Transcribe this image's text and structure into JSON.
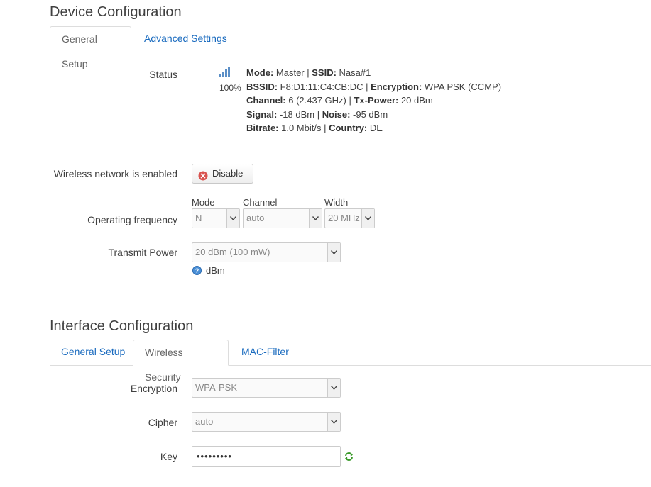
{
  "device": {
    "title": "Device Configuration",
    "tabs": [
      {
        "label": "General Setup",
        "active": true
      },
      {
        "label": "Advanced Settings",
        "active": false
      }
    ],
    "status": {
      "label": "Status",
      "signal_percent": "100%",
      "lines": [
        {
          "k1": "Mode:",
          "v1": " Master | ",
          "k2": "SSID:",
          "v2": " Nasa#1",
          "k3": "",
          "v3": ""
        },
        {
          "k1": "BSSID:",
          "v1": " F8:D1:11:C4:CB:DC | ",
          "k2": "Encryption:",
          "v2": " WPA PSK (CCMP)",
          "k3": "",
          "v3": ""
        },
        {
          "k1": "Channel:",
          "v1": " 6 (2.437 GHz) | ",
          "k2": "Tx-Power:",
          "v2": " 20 dBm",
          "k3": "",
          "v3": ""
        },
        {
          "k1": "Signal:",
          "v1": " -18 dBm | ",
          "k2": "Noise:",
          "v2": " -95 dBm",
          "k3": "",
          "v3": ""
        },
        {
          "k1": "Bitrate:",
          "v1": " 1.0 Mbit/s | ",
          "k2": "Country:",
          "v2": " DE",
          "k3": "",
          "v3": ""
        }
      ]
    },
    "wireless_enabled": {
      "label": "Wireless network is enabled",
      "button": "Disable"
    },
    "operating_frequency": {
      "label": "Operating frequency",
      "mode": {
        "label": "Mode",
        "value": "N"
      },
      "channel": {
        "label": "Channel",
        "value": "auto"
      },
      "width": {
        "label": "Width",
        "value": "20 MHz"
      }
    },
    "transmit_power": {
      "label": "Transmit Power",
      "value": "20 dBm (100 mW)",
      "hint": "dBm"
    }
  },
  "interface": {
    "title": "Interface Configuration",
    "tabs": [
      {
        "label": "General Setup",
        "active": false
      },
      {
        "label": "Wireless Security",
        "active": true
      },
      {
        "label": "MAC-Filter",
        "active": false
      }
    ],
    "encryption": {
      "label": "Encryption",
      "value": "WPA-PSK"
    },
    "cipher": {
      "label": "Cipher",
      "value": "auto"
    },
    "key": {
      "label": "Key",
      "value": "•••••••••"
    }
  },
  "colors": {
    "link": "#1a6bbf",
    "signal_bars": "#5b8fc7",
    "disable_icon": "#d9534f",
    "help_icon": "#4a8fd6",
    "refresh_icon": "#3a9a2a"
  }
}
